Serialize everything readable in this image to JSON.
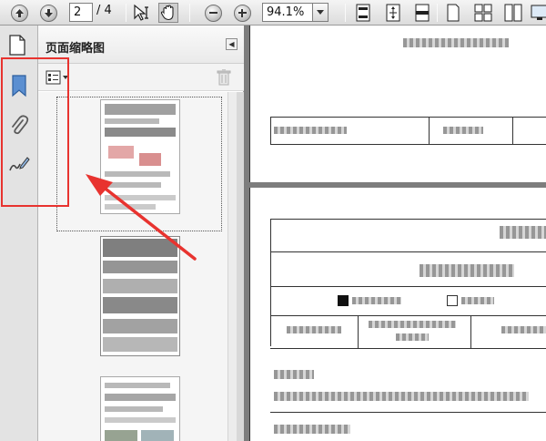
{
  "toolbar": {
    "page_current": "2",
    "page_total": "/ 4",
    "zoom": "94.1%"
  },
  "panel": {
    "title": "页面缩略图"
  },
  "colors": {
    "highlight": "#e8332f",
    "arrow": "#e8332f"
  },
  "icons": {
    "prev_page": "up-arrow-icon",
    "next_page": "down-arrow-icon",
    "select_tool": "select-tool-icon",
    "hand_tool": "hand-tool-icon",
    "zoom_out": "minus-icon",
    "zoom_in": "plus-icon",
    "pages_panel": "pages-icon",
    "bookmarks": "bookmark-icon",
    "attachments": "paperclip-icon",
    "signatures": "signature-icon",
    "options": "options-menu-icon",
    "delete": "trash-icon"
  }
}
